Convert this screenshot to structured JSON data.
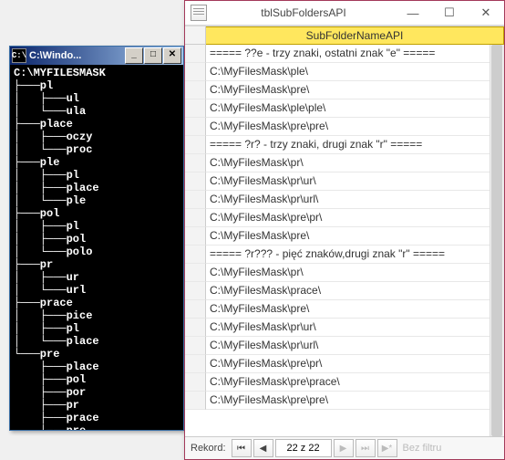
{
  "console": {
    "title": "C:\\Windo...",
    "icon_label": "C:\\",
    "tree_text": "C:\\MYFILESMASK\n├───pl\n│   ├───ul\n│   └───ula\n├───place\n│   ├───oczy\n│   └───proc\n├───ple\n│   ├───pl\n│   ├───place\n│   └───ple\n├───pol\n│   ├───pl\n│   ├───pol\n│   └───polo\n├───pr\n│   ├───ur\n│   └───url\n├───prace\n│   ├───pice\n│   ├───pl\n│   └───place\n└───pre\n    ├───place\n    ├───pol\n    ├───por\n    ├───pr\n    ├───prace\n    └───pre"
  },
  "access": {
    "title": "tblSubFoldersAPI",
    "column_header": "SubFolderNameAPI",
    "rows": [
      "===== ??e - trzy znaki, ostatni znak \"e\" =====",
      "C:\\MyFilesMask\\ple\\",
      "C:\\MyFilesMask\\pre\\",
      "C:\\MyFilesMask\\ple\\ple\\",
      "C:\\MyFilesMask\\pre\\pre\\",
      "===== ?r? - trzy znaki, drugi znak \"r\"  =====",
      "C:\\MyFilesMask\\pr\\",
      "C:\\MyFilesMask\\pr\\ur\\",
      "C:\\MyFilesMask\\pr\\url\\",
      "C:\\MyFilesMask\\pre\\pr\\",
      "C:\\MyFilesMask\\pre\\",
      "===== ?r??? - pięć znaków,drugi znak \"r\"  =====",
      "C:\\MyFilesMask\\pr\\",
      "C:\\MyFilesMask\\prace\\",
      "C:\\MyFilesMask\\pre\\",
      "C:\\MyFilesMask\\pr\\ur\\",
      "C:\\MyFilesMask\\pr\\url\\",
      "C:\\MyFilesMask\\pre\\pr\\",
      "C:\\MyFilesMask\\pre\\prace\\",
      "C:\\MyFilesMask\\pre\\pre\\"
    ],
    "nav": {
      "label": "Rekord:",
      "position": "22 z 22",
      "filter_label": "Bez filtru"
    }
  }
}
